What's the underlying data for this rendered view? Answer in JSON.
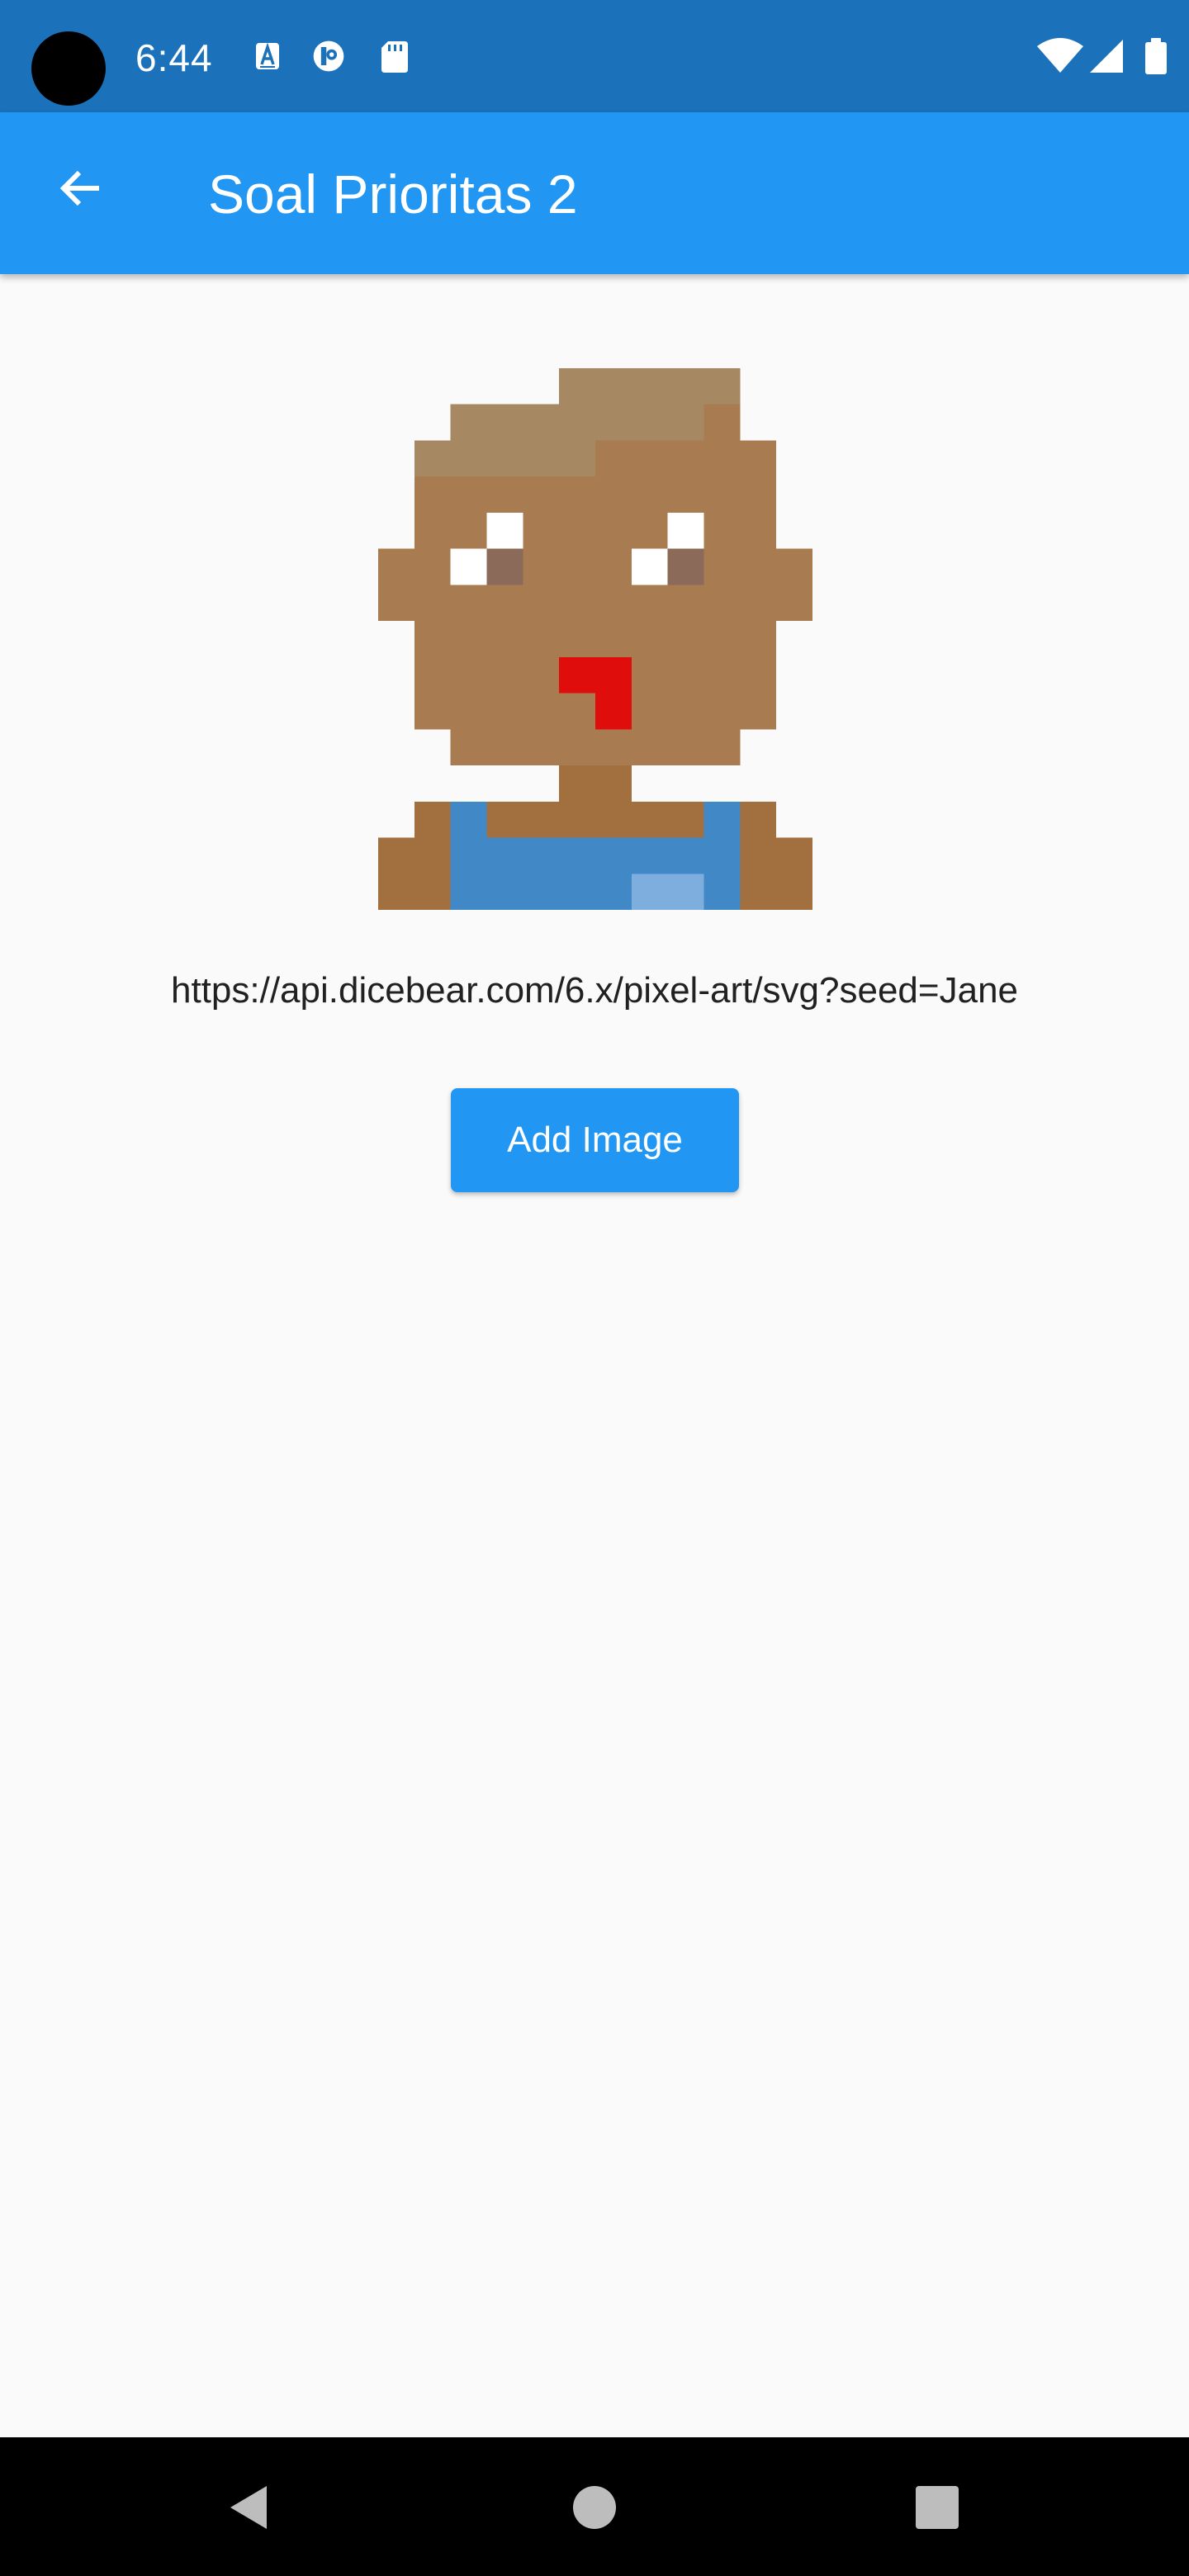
{
  "status_bar": {
    "time": "6:44",
    "icons": [
      "text-a-icon",
      "sync-icon",
      "sd-card-icon",
      "wifi-icon",
      "cellular-signal-icon",
      "battery-icon"
    ]
  },
  "app_bar": {
    "title": "Soal Prioritas 2",
    "back_icon": "arrow-back-icon"
  },
  "main": {
    "avatar_image": "pixel-art-avatar",
    "image_url": "https://api.dicebear.com/6.x/pixel-art/svg?seed=Jane",
    "add_button_label": "Add Image"
  },
  "nav_bar": {
    "icons": [
      "back-triangle-icon",
      "home-circle-icon",
      "recents-square-icon"
    ]
  },
  "colors": {
    "status_bar": "#1B72BB",
    "app_bar": "#2196F3",
    "background": "#FAFAFA",
    "button": "#2196F3",
    "nav_bar": "#000000"
  }
}
